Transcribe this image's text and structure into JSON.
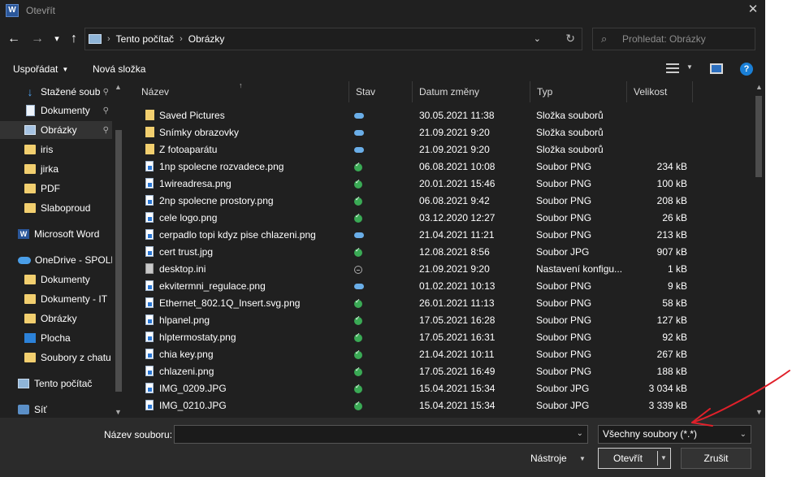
{
  "window": {
    "app_icon": "W",
    "title": "Otevřít",
    "close_glyph": "✕"
  },
  "nav": {
    "back_glyph": "←",
    "forward_glyph": "→",
    "recent_glyph": "▾",
    "up_glyph": "↑",
    "breadcrumb": [
      "Tento počítač",
      "Obrázky"
    ],
    "breadcrumb_sep": "›",
    "address_chevron": "⌄",
    "refresh_glyph": "↻",
    "search_placeholder": "Prohledat: Obrázky",
    "search_icon_glyph": "⌕"
  },
  "toolbar": {
    "organize_label": "Uspořádat",
    "new_folder_label": "Nová složka",
    "help_glyph": "?"
  },
  "sidebar": {
    "items": [
      {
        "label": "Stažené soub",
        "icon": "download-icon",
        "pinned": true
      },
      {
        "label": "Dokumenty",
        "icon": "documents-icon",
        "pinned": true
      },
      {
        "label": "Obrázky",
        "icon": "pictures-icon",
        "pinned": true,
        "selected": true
      },
      {
        "label": "iris",
        "icon": "folder-icon"
      },
      {
        "label": "jirka",
        "icon": "folder-icon"
      },
      {
        "label": "PDF",
        "icon": "folder-icon"
      },
      {
        "label": "Slaboproud",
        "icon": "folder-icon"
      },
      {
        "label": "Microsoft Word",
        "icon": "word-icon"
      },
      {
        "label": "OneDrive - SPOLE",
        "icon": "onedrive-icon"
      },
      {
        "label": "Dokumenty",
        "icon": "documents-icon"
      },
      {
        "label": "Dokumenty - IT",
        "icon": "shared-folder-icon"
      },
      {
        "label": "Obrázky",
        "icon": "pictures-icon"
      },
      {
        "label": "Plocha",
        "icon": "desktop-icon"
      },
      {
        "label": "Soubory z chatu",
        "icon": "folder-icon"
      },
      {
        "label": "Tento počítač",
        "icon": "computer-icon"
      },
      {
        "label": "Síť",
        "icon": "network-icon"
      }
    ],
    "pin_glyph": "📌"
  },
  "columns": {
    "name": "Název",
    "status": "Stav",
    "date": "Datum změny",
    "type": "Typ",
    "size": "Velikost"
  },
  "files": [
    {
      "name": "Saved Pictures",
      "status": "cloud",
      "date": "30.05.2021 11:38",
      "type": "Složka souborů",
      "size": "",
      "icon": "folder"
    },
    {
      "name": "Snímky obrazovky",
      "status": "cloud",
      "date": "21.09.2021 9:20",
      "type": "Složka souborů",
      "size": "",
      "icon": "folder"
    },
    {
      "name": "Z fotoaparátu",
      "status": "cloud",
      "date": "21.09.2021 9:20",
      "type": "Složka souborů",
      "size": "",
      "icon": "folder"
    },
    {
      "name": "1np spolecne rozvadece.png",
      "status": "ok",
      "date": "06.08.2021 10:08",
      "type": "Soubor PNG",
      "size": "234 kB",
      "icon": "png"
    },
    {
      "name": "1wireadresa.png",
      "status": "ok",
      "date": "20.01.2021 15:46",
      "type": "Soubor PNG",
      "size": "100 kB",
      "icon": "png"
    },
    {
      "name": "2np spolecne prostory.png",
      "status": "ok",
      "date": "06.08.2021 9:42",
      "type": "Soubor PNG",
      "size": "208 kB",
      "icon": "png"
    },
    {
      "name": "cele logo.png",
      "status": "ok",
      "date": "03.12.2020 12:27",
      "type": "Soubor PNG",
      "size": "26 kB",
      "icon": "png"
    },
    {
      "name": "cerpadlo topi kdyz pise chlazeni.png",
      "status": "cloud",
      "date": "21.04.2021 11:21",
      "type": "Soubor PNG",
      "size": "213 kB",
      "icon": "png"
    },
    {
      "name": "cert trust.jpg",
      "status": "ok",
      "date": "12.08.2021 8:56",
      "type": "Soubor JPG",
      "size": "907 kB",
      "icon": "png"
    },
    {
      "name": "desktop.ini",
      "status": "na",
      "date": "21.09.2021 9:20",
      "type": "Nastavení konfigu...",
      "size": "1 kB",
      "icon": "ini"
    },
    {
      "name": "ekvitermni_regulace.png",
      "status": "cloud",
      "date": "01.02.2021 10:13",
      "type": "Soubor PNG",
      "size": "9 kB",
      "icon": "png"
    },
    {
      "name": "Ethernet_802.1Q_Insert.svg.png",
      "status": "ok",
      "date": "26.01.2021 11:13",
      "type": "Soubor PNG",
      "size": "58 kB",
      "icon": "png"
    },
    {
      "name": "hlpanel.png",
      "status": "ok",
      "date": "17.05.2021 16:28",
      "type": "Soubor PNG",
      "size": "127 kB",
      "icon": "png"
    },
    {
      "name": "hlptermostaty.png",
      "status": "ok",
      "date": "17.05.2021 16:31",
      "type": "Soubor PNG",
      "size": "92 kB",
      "icon": "png"
    },
    {
      "name": "chia key.png",
      "status": "ok",
      "date": "21.04.2021 10:11",
      "type": "Soubor PNG",
      "size": "267 kB",
      "icon": "png"
    },
    {
      "name": "chlazeni.png",
      "status": "ok",
      "date": "17.05.2021 16:49",
      "type": "Soubor PNG",
      "size": "188 kB",
      "icon": "png"
    },
    {
      "name": "IMG_0209.JPG",
      "status": "ok",
      "date": "15.04.2021 15:34",
      "type": "Soubor JPG",
      "size": "3 034 kB",
      "icon": "png"
    },
    {
      "name": "IMG_0210.JPG",
      "status": "ok",
      "date": "15.04.2021 15:34",
      "type": "Soubor JPG",
      "size": "3 339 kB",
      "icon": "png"
    }
  ],
  "footer": {
    "filename_label": "Název souboru:",
    "filename_value": "",
    "filetype_value": "Všechny soubory (*.*)",
    "tools_label": "Nástroje",
    "open_label": "Otevřít",
    "cancel_label": "Zrušit",
    "chevron_glyph": "⌄",
    "dropdown_glyph": "▼"
  },
  "scroll": {
    "up_glyph": "▲",
    "down_glyph": "▼"
  },
  "colors": {
    "background": "#202020",
    "folder": "#f2cf6f",
    "accent_blue": "#1a7fd6",
    "sync_ok": "#3aaa55",
    "annotation_red": "#e0202a"
  }
}
